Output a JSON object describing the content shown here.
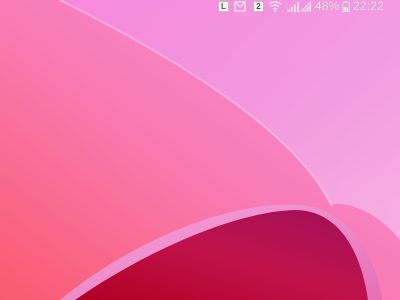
{
  "status_bar": {
    "notification_icons": [
      "screenshot-icon",
      "mail-icon"
    ],
    "notification_count": "2",
    "battery_percent": "48%",
    "battery_level": 0.48,
    "time": "22:22"
  },
  "wallpaper": {
    "colors": {
      "top_right": "#f78ce0",
      "left": "#fa6f8a",
      "fold_highlight": "#ffb3e6",
      "curl_dark": "#b2002f",
      "curl_mid": "#c81046"
    }
  }
}
